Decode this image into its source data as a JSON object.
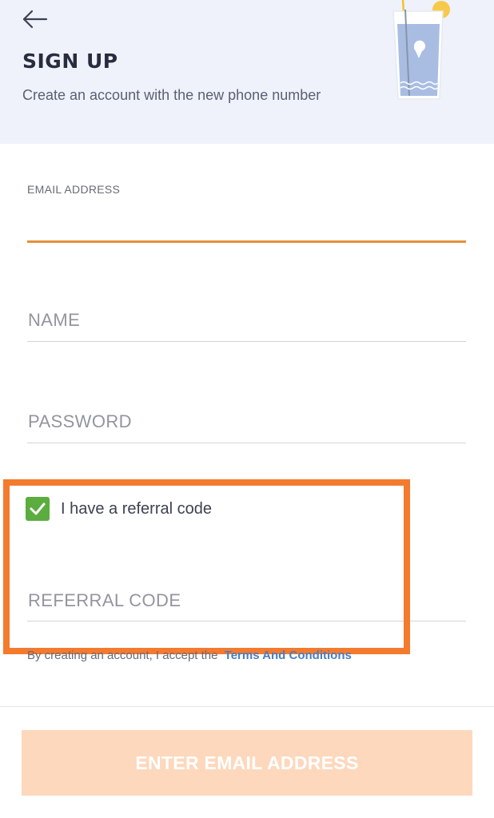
{
  "header": {
    "title": "SIGN UP",
    "subtitle": "Create an account with the new phone number",
    "back_icon": "arrow-left-icon",
    "illustration": "drink-glass-illustration"
  },
  "form": {
    "email": {
      "label": "EMAIL ADDRESS",
      "value": ""
    },
    "name": {
      "placeholder": "NAME",
      "value": ""
    },
    "password": {
      "placeholder": "PASSWORD",
      "value": ""
    },
    "referral_toggle": {
      "label": "I have a referral code",
      "checked": true
    },
    "referral_code": {
      "placeholder": "REFERRAL CODE",
      "value": ""
    }
  },
  "terms": {
    "text": "By creating an account, I accept the",
    "link": "Terms And Conditions"
  },
  "cta": {
    "label": "ENTER EMAIL ADDRESS"
  },
  "colors": {
    "header_bg": "#eff2fa",
    "accent_orange": "#e3913b",
    "highlight": "#f47a2e",
    "checkbox_green": "#5aad3e",
    "link_blue": "#4a7ec2",
    "cta_disabled": "#fdd8bd"
  }
}
